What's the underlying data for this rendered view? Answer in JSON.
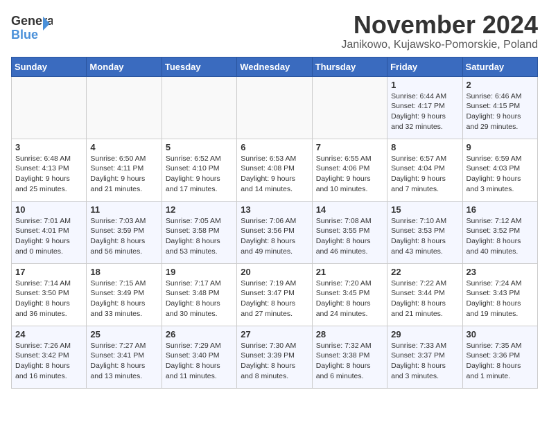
{
  "header": {
    "logo_general": "General",
    "logo_blue": "Blue",
    "month_title": "November 2024",
    "location": "Janikowo, Kujawsko-Pomorskie, Poland"
  },
  "days_of_week": [
    "Sunday",
    "Monday",
    "Tuesday",
    "Wednesday",
    "Thursday",
    "Friday",
    "Saturday"
  ],
  "weeks": [
    [
      {
        "day": "",
        "info": ""
      },
      {
        "day": "",
        "info": ""
      },
      {
        "day": "",
        "info": ""
      },
      {
        "day": "",
        "info": ""
      },
      {
        "day": "",
        "info": ""
      },
      {
        "day": "1",
        "info": "Sunrise: 6:44 AM\nSunset: 4:17 PM\nDaylight: 9 hours\nand 32 minutes."
      },
      {
        "day": "2",
        "info": "Sunrise: 6:46 AM\nSunset: 4:15 PM\nDaylight: 9 hours\nand 29 minutes."
      }
    ],
    [
      {
        "day": "3",
        "info": "Sunrise: 6:48 AM\nSunset: 4:13 PM\nDaylight: 9 hours\nand 25 minutes."
      },
      {
        "day": "4",
        "info": "Sunrise: 6:50 AM\nSunset: 4:11 PM\nDaylight: 9 hours\nand 21 minutes."
      },
      {
        "day": "5",
        "info": "Sunrise: 6:52 AM\nSunset: 4:10 PM\nDaylight: 9 hours\nand 17 minutes."
      },
      {
        "day": "6",
        "info": "Sunrise: 6:53 AM\nSunset: 4:08 PM\nDaylight: 9 hours\nand 14 minutes."
      },
      {
        "day": "7",
        "info": "Sunrise: 6:55 AM\nSunset: 4:06 PM\nDaylight: 9 hours\nand 10 minutes."
      },
      {
        "day": "8",
        "info": "Sunrise: 6:57 AM\nSunset: 4:04 PM\nDaylight: 9 hours\nand 7 minutes."
      },
      {
        "day": "9",
        "info": "Sunrise: 6:59 AM\nSunset: 4:03 PM\nDaylight: 9 hours\nand 3 minutes."
      }
    ],
    [
      {
        "day": "10",
        "info": "Sunrise: 7:01 AM\nSunset: 4:01 PM\nDaylight: 9 hours\nand 0 minutes."
      },
      {
        "day": "11",
        "info": "Sunrise: 7:03 AM\nSunset: 3:59 PM\nDaylight: 8 hours\nand 56 minutes."
      },
      {
        "day": "12",
        "info": "Sunrise: 7:05 AM\nSunset: 3:58 PM\nDaylight: 8 hours\nand 53 minutes."
      },
      {
        "day": "13",
        "info": "Sunrise: 7:06 AM\nSunset: 3:56 PM\nDaylight: 8 hours\nand 49 minutes."
      },
      {
        "day": "14",
        "info": "Sunrise: 7:08 AM\nSunset: 3:55 PM\nDaylight: 8 hours\nand 46 minutes."
      },
      {
        "day": "15",
        "info": "Sunrise: 7:10 AM\nSunset: 3:53 PM\nDaylight: 8 hours\nand 43 minutes."
      },
      {
        "day": "16",
        "info": "Sunrise: 7:12 AM\nSunset: 3:52 PM\nDaylight: 8 hours\nand 40 minutes."
      }
    ],
    [
      {
        "day": "17",
        "info": "Sunrise: 7:14 AM\nSunset: 3:50 PM\nDaylight: 8 hours\nand 36 minutes."
      },
      {
        "day": "18",
        "info": "Sunrise: 7:15 AM\nSunset: 3:49 PM\nDaylight: 8 hours\nand 33 minutes."
      },
      {
        "day": "19",
        "info": "Sunrise: 7:17 AM\nSunset: 3:48 PM\nDaylight: 8 hours\nand 30 minutes."
      },
      {
        "day": "20",
        "info": "Sunrise: 7:19 AM\nSunset: 3:47 PM\nDaylight: 8 hours\nand 27 minutes."
      },
      {
        "day": "21",
        "info": "Sunrise: 7:20 AM\nSunset: 3:45 PM\nDaylight: 8 hours\nand 24 minutes."
      },
      {
        "day": "22",
        "info": "Sunrise: 7:22 AM\nSunset: 3:44 PM\nDaylight: 8 hours\nand 21 minutes."
      },
      {
        "day": "23",
        "info": "Sunrise: 7:24 AM\nSunset: 3:43 PM\nDaylight: 8 hours\nand 19 minutes."
      }
    ],
    [
      {
        "day": "24",
        "info": "Sunrise: 7:26 AM\nSunset: 3:42 PM\nDaylight: 8 hours\nand 16 minutes."
      },
      {
        "day": "25",
        "info": "Sunrise: 7:27 AM\nSunset: 3:41 PM\nDaylight: 8 hours\nand 13 minutes."
      },
      {
        "day": "26",
        "info": "Sunrise: 7:29 AM\nSunset: 3:40 PM\nDaylight: 8 hours\nand 11 minutes."
      },
      {
        "day": "27",
        "info": "Sunrise: 7:30 AM\nSunset: 3:39 PM\nDaylight: 8 hours\nand 8 minutes."
      },
      {
        "day": "28",
        "info": "Sunrise: 7:32 AM\nSunset: 3:38 PM\nDaylight: 8 hours\nand 6 minutes."
      },
      {
        "day": "29",
        "info": "Sunrise: 7:33 AM\nSunset: 3:37 PM\nDaylight: 8 hours\nand 3 minutes."
      },
      {
        "day": "30",
        "info": "Sunrise: 7:35 AM\nSunset: 3:36 PM\nDaylight: 8 hours\nand 1 minute."
      }
    ]
  ]
}
